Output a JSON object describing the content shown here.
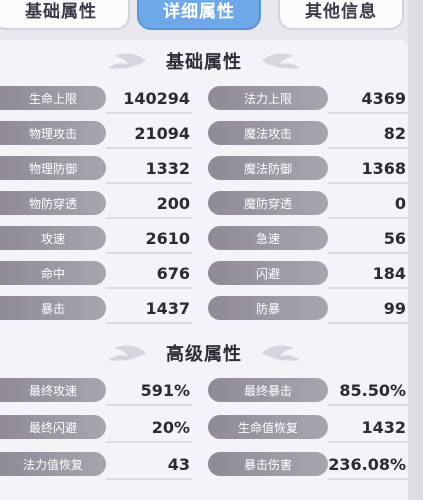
{
  "tabs": [
    "基础属性",
    "详细属性",
    "其他信息"
  ],
  "sections": [
    {
      "title": "基础属性",
      "rows": [
        {
          "left_label": "生命上限",
          "left_value": "140294",
          "right_label": "法力上限",
          "right_value": "4369"
        },
        {
          "left_label": "物理攻击",
          "left_value": "21094",
          "right_label": "魔法攻击",
          "right_value": "82"
        },
        {
          "left_label": "物理防御",
          "left_value": "1332",
          "right_label": "魔法防御",
          "right_value": "1368"
        },
        {
          "left_label": "物防穿透",
          "left_value": "200",
          "right_label": "魔防穿透",
          "right_value": "0"
        },
        {
          "left_label": "攻速",
          "left_value": "2610",
          "right_label": "急速",
          "right_value": "56"
        },
        {
          "left_label": "命中",
          "left_value": "676",
          "right_label": "闪避",
          "right_value": "184"
        },
        {
          "left_label": "暴击",
          "left_value": "1437",
          "right_label": "防暴",
          "right_value": "99"
        }
      ]
    },
    {
      "title": "高级属性",
      "rows": [
        {
          "left_label": "最终攻速",
          "left_value": "591%",
          "right_label": "最终暴击",
          "right_value": "85.50%"
        },
        {
          "left_label": "最终闪避",
          "left_value": "20%",
          "right_label": "生命值恢复",
          "right_value": "1432"
        },
        {
          "left_label": "法力值恢复",
          "left_value": "43",
          "right_label": "暴击伤害",
          "right_value": "236.08%"
        }
      ]
    }
  ]
}
